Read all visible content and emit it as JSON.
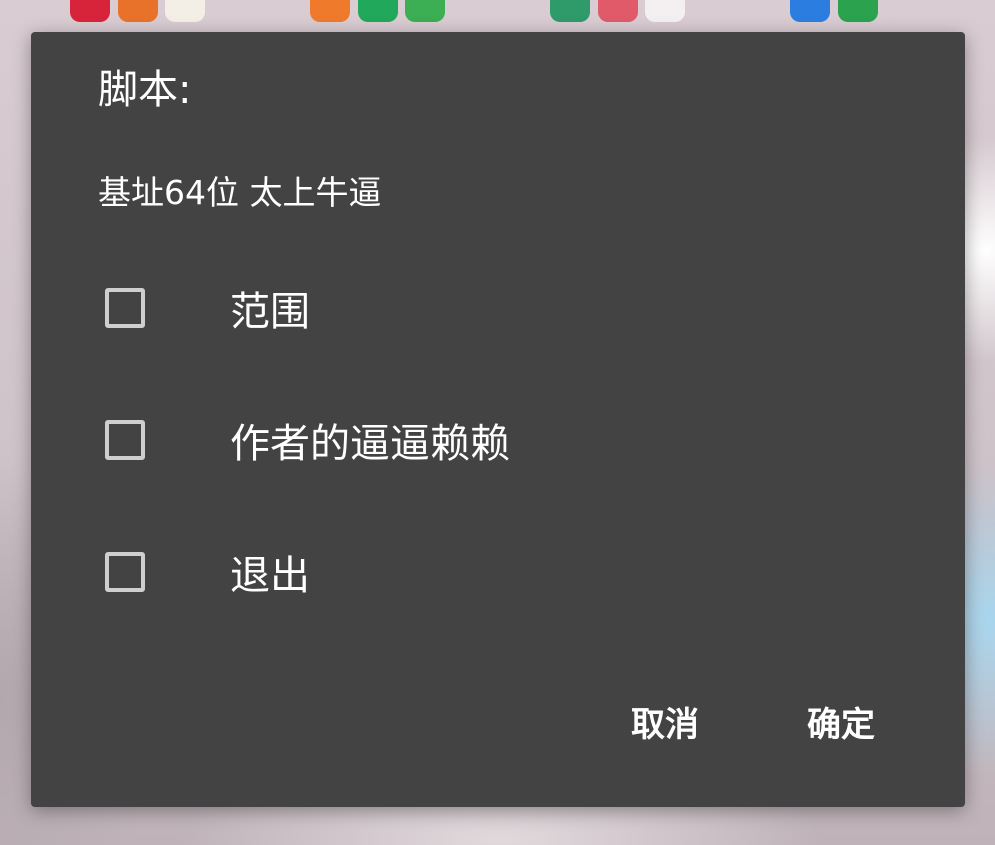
{
  "dialog": {
    "title": "脚本:",
    "message": "基址64位 太上牛逼",
    "options": [
      {
        "label": "范围",
        "checked": false
      },
      {
        "label": "作者的逼逼赖赖",
        "checked": false
      },
      {
        "label": "退出",
        "checked": false
      }
    ],
    "buttons": {
      "cancel": "取消",
      "confirm": "确定"
    }
  },
  "colors": {
    "dialog_background": "#434343",
    "text": "#ffffff",
    "checkbox_border": "#cfcfcf"
  }
}
